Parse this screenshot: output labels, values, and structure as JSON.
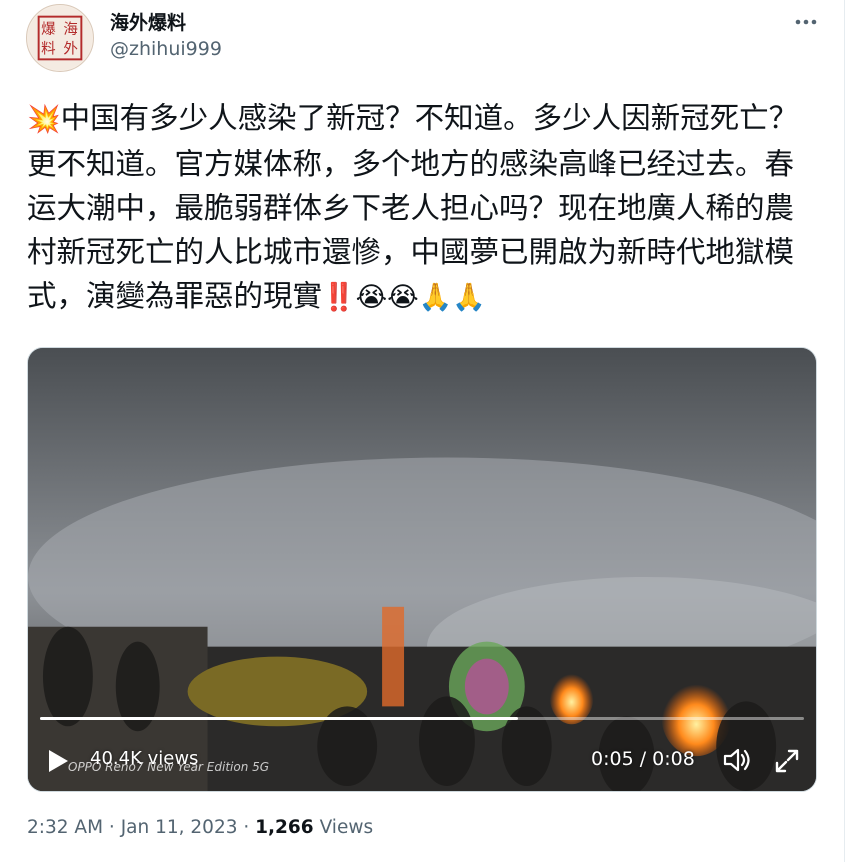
{
  "account": {
    "display_name": "海外爆料",
    "handle": "@zhihui999",
    "avatar_text": "爆海料外",
    "more_icon": "more-dots-icon"
  },
  "tweet": {
    "lead_emoji": "💥",
    "text": "中国有多少人感染了新冠？不知道。多少人因新冠死亡？更不知道。官方媒体称，多个地方的感染高峰已经过去。春运大潮中，最脆弱群体乡下老人担心吗？现在地廣人稀的農村新冠死亡的人比城市還慘，中國夢已開啟为新時代地獄模式，演變為罪惡的現實",
    "trailing_emojis": "‼️😭😭🙏🙏"
  },
  "media": {
    "views": "40.4K views",
    "time": "0:05 / 0:08",
    "progress": 0.625,
    "watermark": "OPPO Reno7 New Year Edition 5G",
    "icons": [
      "play-icon",
      "volume-icon",
      "fullscreen-icon"
    ]
  },
  "meta": {
    "time": "2:32 AM",
    "separator": " · ",
    "date": "Jan 11, 2023",
    "views_count": "1,266",
    "views_label": "Views"
  },
  "colors": {
    "text": "#0f1419",
    "secondary": "#536471"
  }
}
